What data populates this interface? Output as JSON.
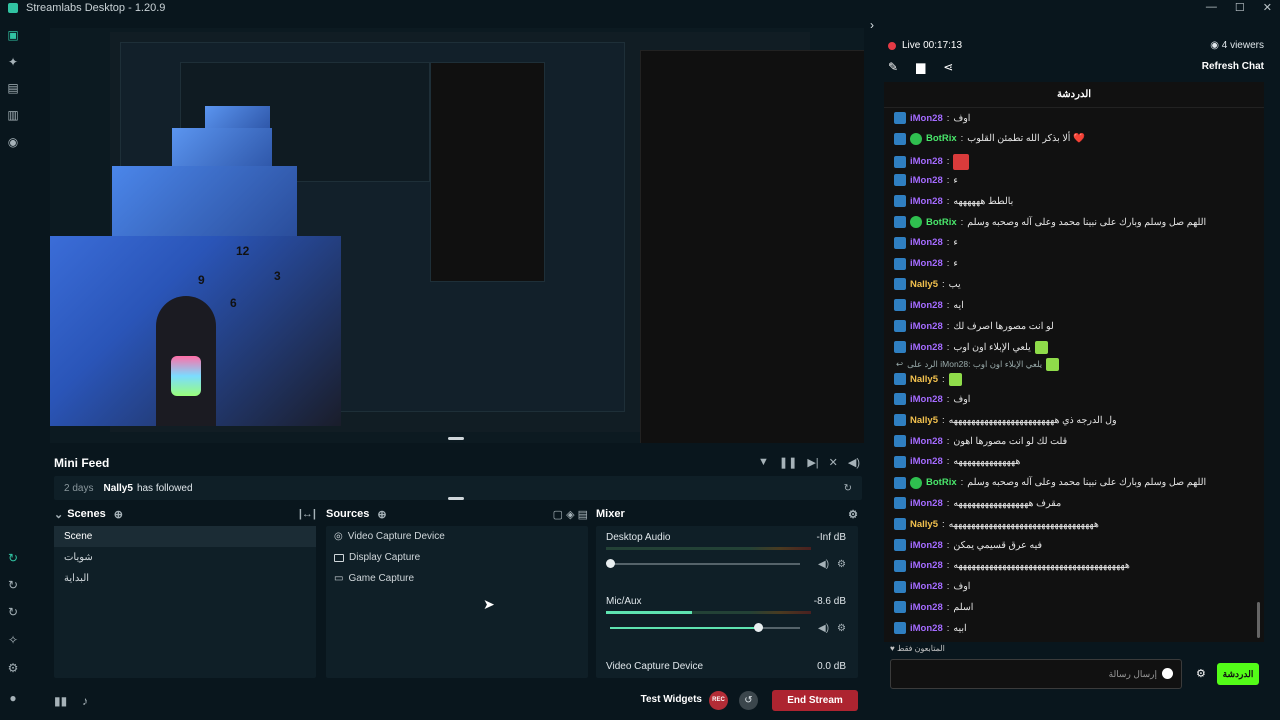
{
  "window": {
    "title": "Streamlabs Desktop - 1.20.9",
    "controls": [
      "—",
      "☐",
      "✕"
    ]
  },
  "minifeed": {
    "title": "Mini Feed",
    "events": [
      {
        "time": "2 days",
        "user": "Nally5",
        "action": "has followed"
      }
    ]
  },
  "scenes": {
    "title": "Scenes",
    "items": [
      "Scene",
      "شويات",
      "البداية"
    ],
    "selected": "Scene"
  },
  "sources": {
    "title": "Sources",
    "items": [
      "Video Capture Device",
      "Display Capture",
      "Game Capture"
    ]
  },
  "mixer": {
    "title": "Mixer",
    "channels": [
      {
        "name": "Desktop Audio",
        "db": "-Inf dB",
        "meter": 0.0,
        "volume": 0.0
      },
      {
        "name": "Mic/Aux",
        "db": "-8.6 dB",
        "meter": 0.42,
        "volume": 0.78
      },
      {
        "name": "Video Capture Device",
        "db": "0.0 dB"
      }
    ]
  },
  "footer": {
    "test_widgets": "Test Widgets",
    "rec": "REC",
    "end_stream": "End Stream"
  },
  "chat": {
    "live_label": "Live 00:17:13",
    "viewers": "4 viewers",
    "refresh": "Refresh Chat",
    "header": "الدردشة",
    "messages": [
      {
        "user": "iMon28",
        "type": "imon",
        "text": "اوف"
      },
      {
        "user": "BotRix",
        "type": "botrix",
        "text": "ألا بذكر الله تطمئن القلوب ❤️"
      },
      {
        "user": "iMon28",
        "type": "imon",
        "text": "",
        "emote": "red"
      },
      {
        "user": "iMon28",
        "type": "imon",
        "text": "ء"
      },
      {
        "user": "iMon28",
        "type": "imon",
        "text": "بالطط ههههههه"
      },
      {
        "user": "BotRix",
        "type": "botrix",
        "text": "اللهم صل وسلم وبارك على نبينا محمد وعلى آله وصحبه وسلم"
      },
      {
        "user": "iMon28",
        "type": "imon",
        "text": "ء"
      },
      {
        "user": "iMon28",
        "type": "imon",
        "text": "ء"
      },
      {
        "user": "Nally5",
        "type": "nally",
        "text": "يب"
      },
      {
        "user": "iMon28",
        "type": "imon",
        "text": "ايه"
      },
      {
        "user": "iMon28",
        "type": "imon",
        "text": "لو انت مصورها اصرف لك"
      },
      {
        "user": "iMon28",
        "type": "imon",
        "text": "يلعي الإبلاء اون اوب",
        "emote": "green"
      },
      {
        "user": "Nally5",
        "type": "nally",
        "text": "",
        "emote": "green"
      },
      {
        "user": "iMon28",
        "type": "imon",
        "text": "اوف"
      },
      {
        "user": "Nally5",
        "type": "nally",
        "text": "ول الدرجه ذي ههههههههههههههههههههههههه"
      },
      {
        "user": "iMon28",
        "type": "imon",
        "text": "قلت لك لو انت مصورها اهون"
      },
      {
        "user": "iMon28",
        "type": "imon",
        "text": "ههههههههههههههه"
      },
      {
        "user": "BotRix",
        "type": "botrix",
        "text": "اللهم صل وسلم وبارك على نبينا محمد وعلى آله وصحبه وسلم"
      },
      {
        "user": "iMon28",
        "type": "imon",
        "text": "مقرف هههههههههههههههههه"
      },
      {
        "user": "Nally5",
        "type": "nally",
        "text": "هههههههههههههههههههههههههههههههههه"
      },
      {
        "user": "iMon28",
        "type": "imon",
        "text": "فيه عرق قسيمي يمكن"
      },
      {
        "user": "iMon28",
        "type": "imon",
        "text": "هههههههههههههههههههههههههههههههههههههههه"
      },
      {
        "user": "iMon28",
        "type": "imon",
        "text": "اوف"
      },
      {
        "user": "iMon28",
        "type": "imon",
        "text": "اسلم"
      },
      {
        "user": "iMon28",
        "type": "imon",
        "text": "ابيه"
      }
    ],
    "reply_to": "الرد على iMon28: يلعي الإبلاء اون اوب",
    "followers_note": "المتابعون فقط",
    "input_placeholder": "إرسال رسالة",
    "send": "الدردشة"
  },
  "preview_overlay": {
    "clock_numbers": [
      "12",
      "9",
      "3",
      "6"
    ]
  }
}
